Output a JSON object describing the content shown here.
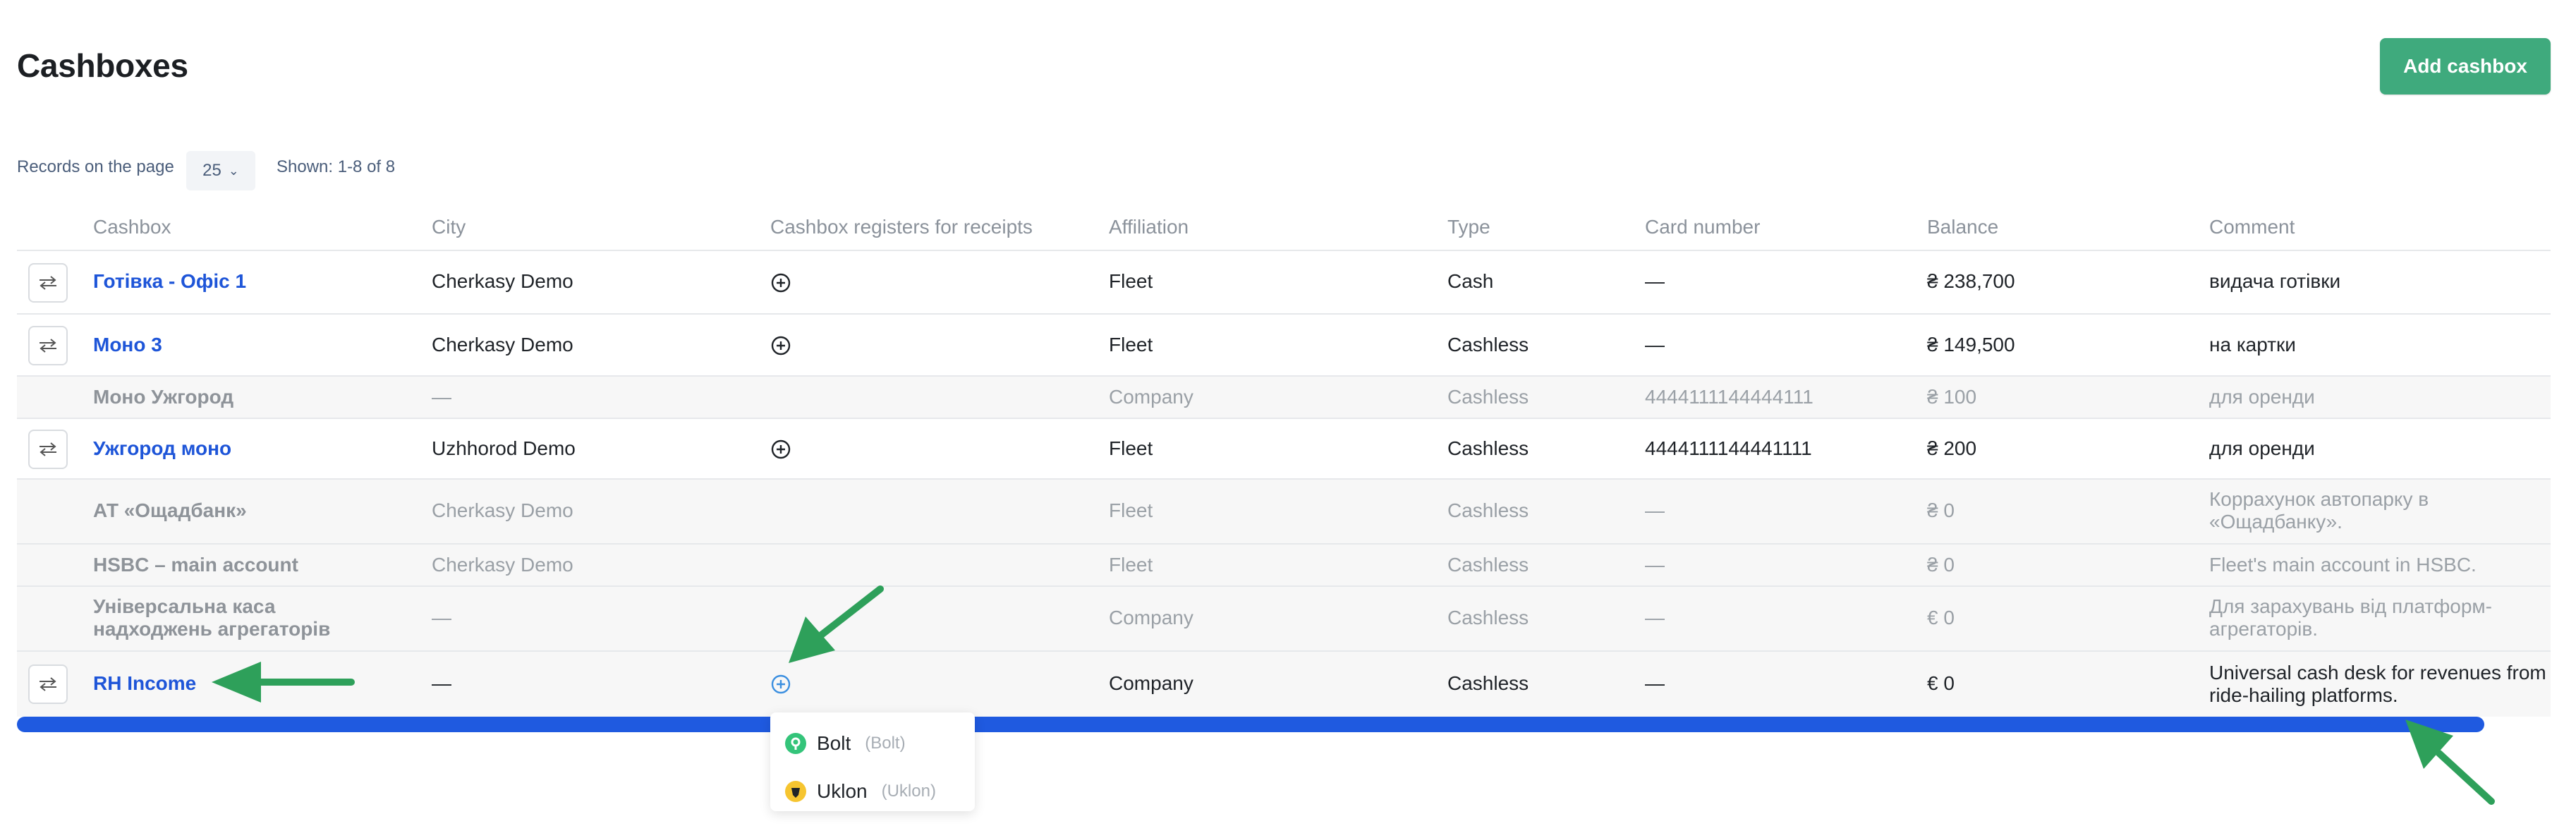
{
  "page": {
    "title": "Cashboxes",
    "add_button": "Add cashbox"
  },
  "pagination": {
    "records_label": "Records on the page",
    "per_page": "25",
    "shown": "Shown: 1-8 of 8"
  },
  "columns": {
    "cashbox": "Cashbox",
    "city": "City",
    "registers": "Cashbox registers for receipts",
    "affiliation": "Affiliation",
    "type": "Type",
    "card": "Card number",
    "balance": "Balance",
    "comment": "Comment"
  },
  "rows": [
    {
      "name": "Готівка - Офіс 1",
      "city": "Cherkasy Demo",
      "affiliation": "Fleet",
      "type": "Cash",
      "card": "—",
      "balance": "₴ 238,700",
      "comment": "видача готівки"
    },
    {
      "name": "Моно 3",
      "city": "Cherkasy Demo",
      "affiliation": "Fleet",
      "type": "Cashless",
      "card": "—",
      "balance": "₴ 149,500",
      "comment": "на картки"
    },
    {
      "name": "Моно Ужгород",
      "city": "—",
      "affiliation": "Company",
      "type": "Cashless",
      "card": "4444111144444111",
      "balance": "₴ 100",
      "comment": "для оренди"
    },
    {
      "name": "Ужгород моно",
      "city": "Uzhhorod Demo",
      "affiliation": "Fleet",
      "type": "Cashless",
      "card": "4444111144441111",
      "balance": "₴ 200",
      "comment": "для оренди"
    },
    {
      "name": "АТ «Ощадбанк»",
      "city": "Cherkasy Demo",
      "affiliation": "Fleet",
      "type": "Cashless",
      "card": "—",
      "balance": "₴ 0",
      "comment": "Коррахунок автопарку в «Ощадбанку»."
    },
    {
      "name": "HSBC – main account",
      "city": "Cherkasy Demo",
      "affiliation": "Fleet",
      "type": "Cashless",
      "card": "—",
      "balance": "₴ 0",
      "comment": "Fleet's main account in HSBC."
    },
    {
      "name": "Універсальна каса надходжень агрегаторів",
      "city": "—",
      "affiliation": "Company",
      "type": "Cashless",
      "card": "—",
      "balance": "€ 0",
      "comment": "Для зарахувань від платформ-агрегаторів."
    },
    {
      "name": "RH Income",
      "city": "—",
      "affiliation": "Company",
      "type": "Cashless",
      "card": "—",
      "balance": "€ 0",
      "comment": "Universal cash desk for revenues from ride-hailing platforms."
    }
  ],
  "dropdown": {
    "items": [
      {
        "label": "Bolt",
        "sub": "(Bolt)"
      },
      {
        "label": "Uklon",
        "sub": "(Uklon)"
      }
    ]
  },
  "colors": {
    "accent_green": "#3faa7d",
    "link_blue": "#1e55d8",
    "scrollbar_blue": "#1f5ae0",
    "annotation_arrow": "#2ea05a"
  }
}
